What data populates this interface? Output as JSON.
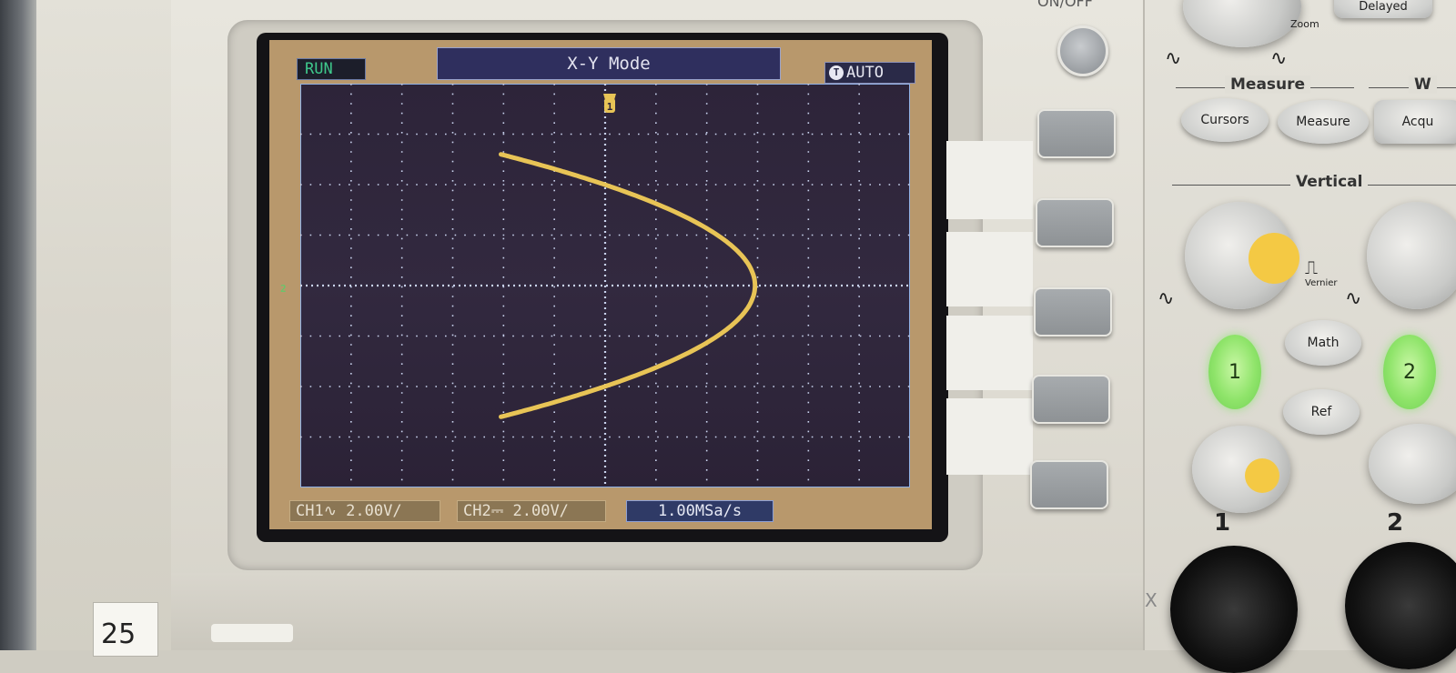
{
  "screen": {
    "run_status": "RUN",
    "mode_title": "X-Y Mode",
    "trigger_icon": "T",
    "trigger_mode": "AUTO",
    "ch1_setting": "CH1∿ 2.00V/",
    "ch2_setting": "CH2⎓ 2.00V/",
    "sample_rate": "1.00MSa/s",
    "trigger_marker": "1",
    "ch2_marker": "2"
  },
  "panel": {
    "onoff_label": "ON/OFF",
    "zoom_label": "Zoom",
    "delayed_label": "Delayed",
    "measure_section": "Measure",
    "cursors_button": "Cursors",
    "measure_button": "Measure",
    "acquire_button": "Acqu",
    "w_section": "W",
    "vertical_section": "Vertical",
    "vernier_label": "Vernier",
    "ch1_button": "1",
    "ch2_button": "2",
    "math_button": "Math",
    "ref_button": "Ref",
    "ch1_input_label": "1",
    "ch2_input_label": "2",
    "x_label": "X"
  },
  "tag_number": "25",
  "colors": {
    "trace": "#e8c456",
    "graticule": "#c9d3ee",
    "screen_bg": "#2f2640",
    "bezel": "#b8986c",
    "channel_green": "#8fe46a"
  }
}
